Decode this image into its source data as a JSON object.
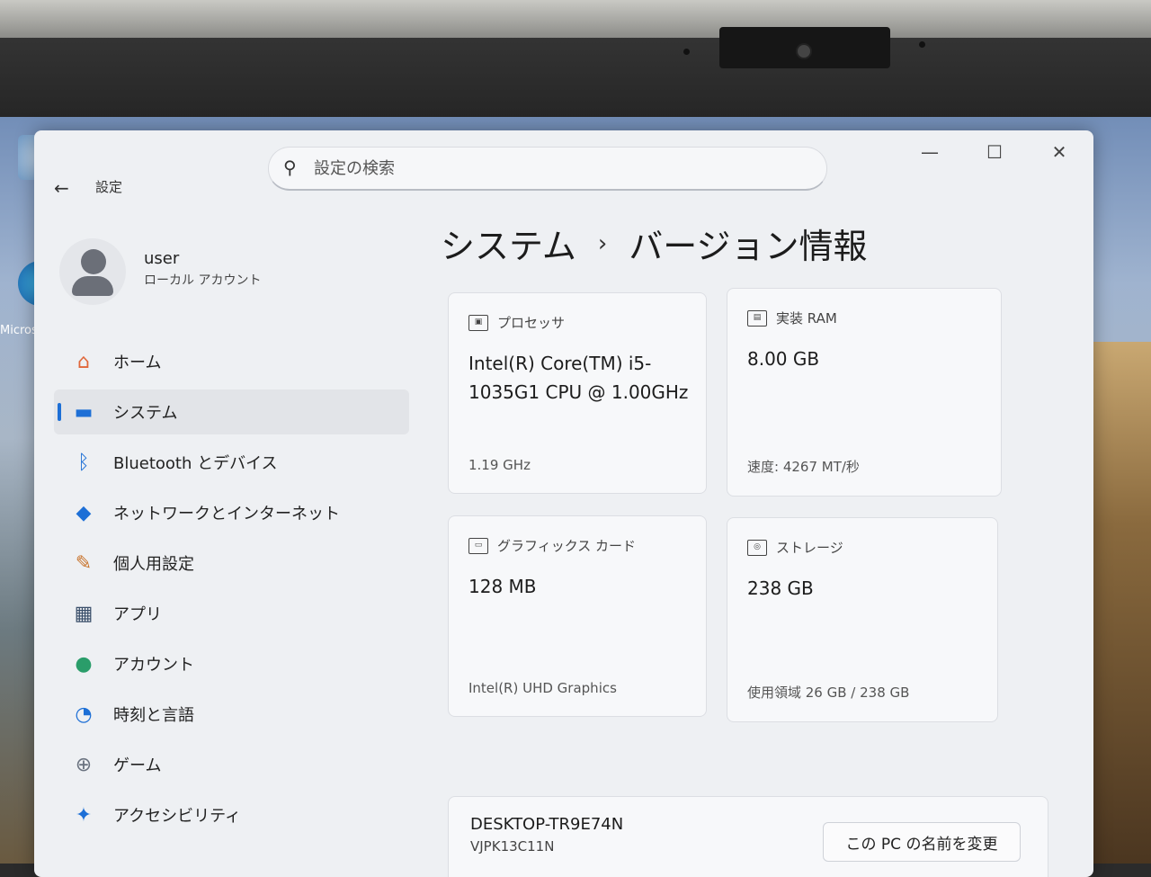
{
  "window": {
    "title": "設定",
    "back_icon": "←",
    "minimize_icon": "—",
    "maximize_icon": "☐",
    "close_icon": "✕"
  },
  "search": {
    "placeholder": "設定の検索",
    "icon": "search-icon"
  },
  "profile": {
    "name": "user",
    "account_type": "ローカル アカウント"
  },
  "sidebar": {
    "items": [
      {
        "label": "ホーム",
        "icon": "home-icon",
        "glyph": "⌂",
        "color": "#e0673a"
      },
      {
        "label": "システム",
        "icon": "system-icon",
        "glyph": "▬",
        "color": "#1d6fd6"
      },
      {
        "label": "Bluetooth とデバイス",
        "icon": "bluetooth-icon",
        "glyph": "ᛒ",
        "color": "#1d6fd6"
      },
      {
        "label": "ネットワークとインターネット",
        "icon": "wifi-icon",
        "glyph": "◆",
        "color": "#1d6fd6"
      },
      {
        "label": "個人用設定",
        "icon": "brush-icon",
        "glyph": "✎",
        "color": "#c9752e"
      },
      {
        "label": "アプリ",
        "icon": "apps-icon",
        "glyph": "▦",
        "color": "#3a4f6a"
      },
      {
        "label": "アカウント",
        "icon": "account-icon",
        "glyph": "●",
        "color": "#2a9d6a"
      },
      {
        "label": "時刻と言語",
        "icon": "clock-globe-icon",
        "glyph": "◔",
        "color": "#1d6fd6"
      },
      {
        "label": "ゲーム",
        "icon": "gamepad-icon",
        "glyph": "⊕",
        "color": "#6b7380"
      },
      {
        "label": "アクセシビリティ",
        "icon": "accessibility-icon",
        "glyph": "✦",
        "color": "#1d6fd6"
      }
    ],
    "active_index": 1
  },
  "breadcrumb": {
    "parent": "システム",
    "separator": "›",
    "current": "バージョン情報"
  },
  "specs": {
    "processor": {
      "label": "プロセッサ",
      "value": "Intel(R) Core(TM) i5-1035G1 CPU @ 1.00GHz",
      "detail": "1.19 GHz"
    },
    "ram": {
      "label": "実装 RAM",
      "value": "8.00 GB",
      "detail": "速度: 4267 MT/秒"
    },
    "graphics": {
      "label": "グラフィックス カード",
      "value": "128 MB",
      "detail": "Intel(R) UHD Graphics"
    },
    "storage": {
      "label": "ストレージ",
      "value": "238 GB",
      "detail": "使用領域 26 GB / 238 GB"
    }
  },
  "device": {
    "name": "DESKTOP-TR9E74N",
    "model": "VJPK13C11N",
    "rename_label": "この PC の名前を変更"
  },
  "desktop": {
    "icon_label": "Micros"
  }
}
